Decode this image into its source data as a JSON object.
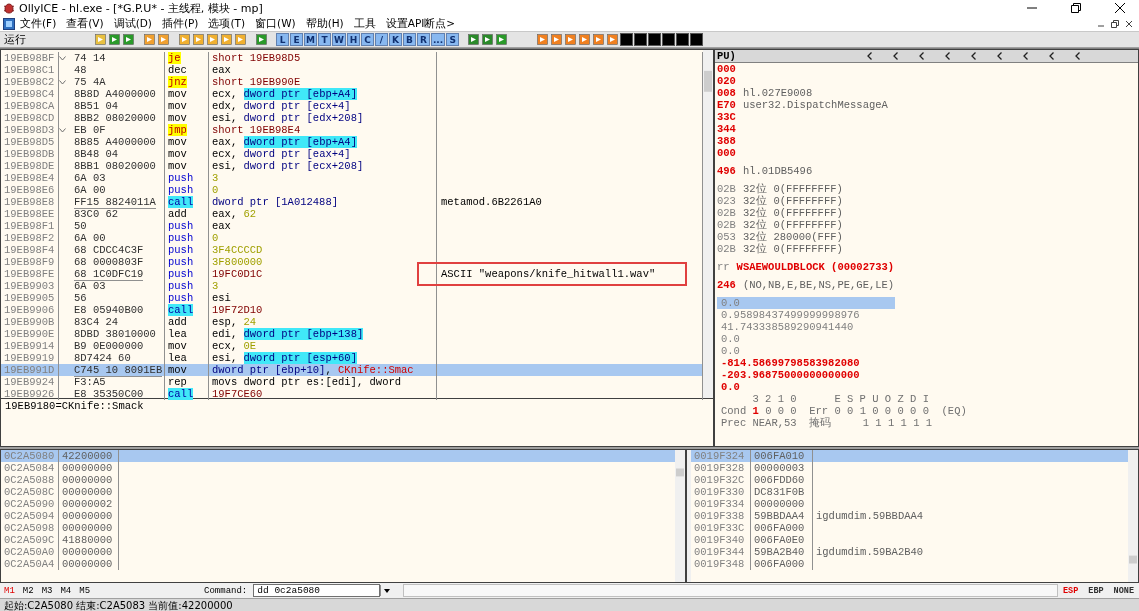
{
  "window": {
    "title": "OllyICE - hl.exe - [*G.P.U* - 主线程, 模块 - mp]"
  },
  "menu": [
    "文件(F)",
    "查看(V)",
    "调试(D)",
    "插件(P)",
    "选项(T)",
    "窗口(W)",
    "帮助(H)",
    "工具",
    "设置API断点>"
  ],
  "toolbar": {
    "status": "运行",
    "window_buttons": [
      "L",
      "E",
      "M",
      "T",
      "W",
      "H",
      "C",
      "/",
      "K",
      "B",
      "R",
      "...",
      "S"
    ]
  },
  "disassembly": {
    "rows": [
      {
        "address": "19EB98BF",
        "jump_mark": true,
        "hex": "74 14",
        "relocated": false,
        "mnemonic": "je",
        "kind": "jump",
        "operands": [
          {
            "text": "short 19EB98D5",
            "kind": "target"
          }
        ],
        "selected": false
      },
      {
        "address": "19EB98C1",
        "jump_mark": false,
        "hex": "48",
        "relocated": false,
        "mnemonic": "dec",
        "kind": "plain",
        "operands": [
          {
            "text": "eax",
            "kind": "reg"
          }
        ],
        "selected": false
      },
      {
        "address": "19EB98C2",
        "jump_mark": true,
        "hex": "75 4A",
        "relocated": false,
        "mnemonic": "jnz",
        "kind": "jump",
        "operands": [
          {
            "text": "short 19EB990E",
            "kind": "target"
          }
        ],
        "selected": false
      },
      {
        "address": "19EB98C4",
        "jump_mark": false,
        "hex": "8B8D A4000000",
        "relocated": false,
        "mnemonic": "mov",
        "kind": "plain",
        "operands": [
          {
            "text": "ecx, ",
            "kind": "reg"
          },
          {
            "text": "dword ptr [ebp+A4]",
            "kind": "mem_hl"
          }
        ],
        "selected": false
      },
      {
        "address": "19EB98CA",
        "jump_mark": false,
        "hex": "8B51 04",
        "relocated": false,
        "mnemonic": "mov",
        "kind": "plain",
        "operands": [
          {
            "text": "edx, ",
            "kind": "reg"
          },
          {
            "text": "dword ptr [ecx+4]",
            "kind": "mem"
          }
        ],
        "selected": false
      },
      {
        "address": "19EB98CD",
        "jump_mark": false,
        "hex": "8BB2 08020000",
        "relocated": false,
        "mnemonic": "mov",
        "kind": "plain",
        "operands": [
          {
            "text": "esi, ",
            "kind": "reg"
          },
          {
            "text": "dword ptr [edx+208]",
            "kind": "mem"
          }
        ],
        "selected": false
      },
      {
        "address": "19EB98D3",
        "jump_mark": true,
        "hex": "EB 0F",
        "relocated": false,
        "mnemonic": "jmp",
        "kind": "jump",
        "operands": [
          {
            "text": "short 19EB98E4",
            "kind": "target"
          }
        ],
        "selected": false
      },
      {
        "address": "19EB98D5",
        "jump_mark": false,
        "hex": "8B85 A4000000",
        "relocated": false,
        "mnemonic": "mov",
        "kind": "plain",
        "operands": [
          {
            "text": "eax, ",
            "kind": "reg"
          },
          {
            "text": "dword ptr [ebp+A4]",
            "kind": "mem_hl"
          }
        ],
        "selected": false
      },
      {
        "address": "19EB98DB",
        "jump_mark": false,
        "hex": "8B48 04",
        "relocated": false,
        "mnemonic": "mov",
        "kind": "plain",
        "operands": [
          {
            "text": "ecx, ",
            "kind": "reg"
          },
          {
            "text": "dword ptr [eax+4]",
            "kind": "mem"
          }
        ],
        "selected": false
      },
      {
        "address": "19EB98DE",
        "jump_mark": false,
        "hex": "8BB1 08020000",
        "relocated": false,
        "mnemonic": "mov",
        "kind": "plain",
        "operands": [
          {
            "text": "esi, ",
            "kind": "reg"
          },
          {
            "text": "dword ptr [ecx+208]",
            "kind": "mem"
          }
        ],
        "selected": false
      },
      {
        "address": "19EB98E4",
        "jump_mark": false,
        "hex": "6A 03",
        "relocated": false,
        "mnemonic": "push",
        "kind": "push",
        "operands": [
          {
            "text": "3",
            "kind": "imm"
          }
        ],
        "selected": false
      },
      {
        "address": "19EB98E6",
        "jump_mark": false,
        "hex": "6A 00",
        "relocated": false,
        "mnemonic": "push",
        "kind": "push",
        "operands": [
          {
            "text": "0",
            "kind": "imm"
          }
        ],
        "selected": false
      },
      {
        "address": "19EB98E8",
        "jump_mark": false,
        "hex": "FF15 8824011A",
        "relocated": true,
        "mnemonic": "call",
        "kind": "call",
        "operands": [
          {
            "text": "dword ptr [1A012488]",
            "kind": "mem"
          }
        ],
        "comment": {
          "text": "metamod.6B2261A0",
          "boxed": false
        },
        "selected": false
      },
      {
        "address": "19EB98EE",
        "jump_mark": false,
        "hex": "83C0 62",
        "relocated": false,
        "mnemonic": "add",
        "kind": "plain",
        "operands": [
          {
            "text": "eax, ",
            "kind": "reg"
          },
          {
            "text": "62",
            "kind": "imm"
          }
        ],
        "selected": false
      },
      {
        "address": "19EB98F1",
        "jump_mark": false,
        "hex": "50",
        "relocated": false,
        "mnemonic": "push",
        "kind": "push",
        "operands": [
          {
            "text": "eax",
            "kind": "reg"
          }
        ],
        "selected": false
      },
      {
        "address": "19EB98F2",
        "jump_mark": false,
        "hex": "6A 00",
        "relocated": false,
        "mnemonic": "push",
        "kind": "push",
        "operands": [
          {
            "text": "0",
            "kind": "imm"
          }
        ],
        "selected": false
      },
      {
        "address": "19EB98F4",
        "jump_mark": false,
        "hex": "68 CDCC4C3F",
        "relocated": false,
        "mnemonic": "push",
        "kind": "push",
        "operands": [
          {
            "text": "3F4CCCCD",
            "kind": "imm"
          }
        ],
        "selected": false
      },
      {
        "address": "19EB98F9",
        "jump_mark": false,
        "hex": "68 0000803F",
        "relocated": false,
        "mnemonic": "push",
        "kind": "push",
        "operands": [
          {
            "text": "3F800000",
            "kind": "imm"
          }
        ],
        "selected": false
      },
      {
        "address": "19EB98FE",
        "jump_mark": false,
        "hex": "68 1C0DFC19",
        "relocated": true,
        "mnemonic": "push",
        "kind": "push",
        "operands": [
          {
            "text": "19FC0D1C",
            "kind": "target"
          }
        ],
        "comment": {
          "text": "ASCII \"weapons/knife_hitwall1.wav\"",
          "boxed": true
        },
        "selected": false
      },
      {
        "address": "19EB9903",
        "jump_mark": false,
        "hex": "6A 03",
        "relocated": false,
        "mnemonic": "push",
        "kind": "push",
        "operands": [
          {
            "text": "3",
            "kind": "imm"
          }
        ],
        "selected": false
      },
      {
        "address": "19EB9905",
        "jump_mark": false,
        "hex": "56",
        "relocated": false,
        "mnemonic": "push",
        "kind": "push",
        "operands": [
          {
            "text": "esi",
            "kind": "reg"
          }
        ],
        "selected": false
      },
      {
        "address": "19EB9906",
        "jump_mark": false,
        "hex": "E8 05940B00",
        "relocated": false,
        "mnemonic": "call",
        "kind": "call",
        "operands": [
          {
            "text": "19F72D10",
            "kind": "target"
          }
        ],
        "selected": false
      },
      {
        "address": "19EB990B",
        "jump_mark": false,
        "hex": "83C4 24",
        "relocated": false,
        "mnemonic": "add",
        "kind": "plain",
        "operands": [
          {
            "text": "esp, ",
            "kind": "reg"
          },
          {
            "text": "24",
            "kind": "imm"
          }
        ],
        "selected": false
      },
      {
        "address": "19EB990E",
        "jump_mark": false,
        "hex": "8DBD 38010000",
        "relocated": false,
        "mnemonic": "lea",
        "kind": "plain",
        "operands": [
          {
            "text": "edi, ",
            "kind": "reg"
          },
          {
            "text": "dword ptr [ebp+138]",
            "kind": "mem_hl"
          }
        ],
        "selected": false
      },
      {
        "address": "19EB9914",
        "jump_mark": false,
        "hex": "B9 0E000000",
        "relocated": false,
        "mnemonic": "mov",
        "kind": "plain",
        "operands": [
          {
            "text": "ecx, ",
            "kind": "reg"
          },
          {
            "text": "0E",
            "kind": "imm"
          }
        ],
        "selected": false
      },
      {
        "address": "19EB9919",
        "jump_mark": false,
        "hex": "8D7424 60",
        "relocated": false,
        "mnemonic": "lea",
        "kind": "plain",
        "operands": [
          {
            "text": "esi, ",
            "kind": "reg"
          },
          {
            "text": "dword ptr [esp+60]",
            "kind": "mem_hl"
          }
        ],
        "selected": false
      },
      {
        "address": "19EB991D",
        "jump_mark": false,
        "hex": "C745 10 8091EB",
        "relocated": true,
        "mnemonic": "mov",
        "kind": "plain",
        "operands": [
          {
            "text": "dword ptr [ebp+10]",
            "kind": "mem"
          },
          {
            "text": ", ",
            "kind": "reg"
          },
          {
            "text": "CKnife::Smac",
            "kind": "label"
          }
        ],
        "selected": true
      },
      {
        "address": "19EB9924",
        "jump_mark": false,
        "hex": "F3:A5",
        "relocated": false,
        "mnemonic": "rep",
        "kind": "plain",
        "operands": [
          {
            "text": "movs dword ptr es:[edi], dword",
            "kind": "reg"
          }
        ],
        "selected": false
      },
      {
        "address": "19EB9926",
        "jump_mark": false,
        "hex": "E8 35350C00",
        "relocated": false,
        "mnemonic": "call",
        "kind": "call",
        "operands": [
          {
            "text": "19F7CE60",
            "kind": "target"
          }
        ],
        "selected": false
      }
    ],
    "info": "19EB9180=CKnife::Smack"
  },
  "registers": {
    "header": "PU)",
    "rows": [
      {
        "kind": "reg",
        "value": "000",
        "changed": true
      },
      {
        "kind": "reg",
        "value": "020",
        "changed": true
      },
      {
        "kind": "reg",
        "value": "008",
        "changed": true,
        "comment": "hl.027E9008"
      },
      {
        "kind": "reg",
        "value": "E70",
        "changed": true,
        "comment": "user32.DispatchMessageA"
      },
      {
        "kind": "reg",
        "value": "33C",
        "changed": true
      },
      {
        "kind": "reg",
        "value": "344",
        "changed": true
      },
      {
        "kind": "reg",
        "value": "388",
        "changed": true
      },
      {
        "kind": "reg",
        "value": "000",
        "changed": true
      },
      {
        "kind": "gap"
      },
      {
        "kind": "reg",
        "value": "496",
        "changed": true,
        "comment": "hl.01DB5496"
      },
      {
        "kind": "gap"
      },
      {
        "kind": "seg",
        "value": "02B",
        "bits": "32位",
        "limit": "0(FFFFFFFF)"
      },
      {
        "kind": "seg",
        "value": "023",
        "bits": "32位",
        "limit": "0(FFFFFFFF)"
      },
      {
        "kind": "seg",
        "value": "02B",
        "bits": "32位",
        "limit": "0(FFFFFFFF)"
      },
      {
        "kind": "seg",
        "value": "02B",
        "bits": "32位",
        "limit": "0(FFFFFFFF)"
      },
      {
        "kind": "seg",
        "value": "053",
        "bits": "32位",
        "limit": "280000(FFF)"
      },
      {
        "kind": "seg",
        "value": "02B",
        "bits": "32位",
        "limit": "0(FFFFFFFF)"
      },
      {
        "kind": "gap"
      },
      {
        "kind": "err",
        "label": "rr",
        "message": "WSAEWOULDBLOCK (00002733)"
      },
      {
        "kind": "gap"
      },
      {
        "kind": "reg",
        "value": "246",
        "changed": true,
        "comment": "(NO,NB,E,BE,NS,PE,GE,LE)"
      },
      {
        "kind": "gap"
      },
      {
        "kind": "fpu",
        "value": "0.0",
        "changed": false,
        "selected": true
      },
      {
        "kind": "fpu",
        "value": "0.95898437499999998976",
        "changed": false,
        "selected": false
      },
      {
        "kind": "fpu",
        "value": "41.743338589290941440",
        "changed": false,
        "selected": false
      },
      {
        "kind": "fpu",
        "value": "0.0",
        "changed": false,
        "selected": false
      },
      {
        "kind": "fpu",
        "value": "0.0",
        "changed": false,
        "selected": false
      },
      {
        "kind": "fpu",
        "value": "-814.58699798583982080",
        "changed": true,
        "selected": false
      },
      {
        "kind": "fpu",
        "value": "-203.96875000000000000",
        "changed": true,
        "selected": false
      },
      {
        "kind": "fpu",
        "value": "0.0",
        "changed": true,
        "selected": false
      },
      {
        "kind": "text",
        "parts": [
          {
            "text": "     3 2 1 0      E S P U O Z D I",
            "changed": false
          }
        ]
      },
      {
        "kind": "text",
        "parts": [
          {
            "text": "Cond ",
            "changed": false
          },
          {
            "text": "1",
            "changed": true
          },
          {
            "text": " 0 0 0  Err 0 0 1 0 0 0 0 0  (EQ)",
            "changed": false
          }
        ]
      },
      {
        "kind": "text",
        "parts": [
          {
            "text": "Prec NEAR,53  掩码     1 1 1 1 1 1",
            "changed": false
          }
        ]
      }
    ]
  },
  "dump": {
    "rows": [
      {
        "address": "0C2A5080",
        "value": "42200000",
        "selected": true
      },
      {
        "address": "0C2A5084",
        "value": "00000000",
        "selected": false
      },
      {
        "address": "0C2A5088",
        "value": "00000000",
        "selected": false
      },
      {
        "address": "0C2A508C",
        "value": "00000000",
        "selected": false
      },
      {
        "address": "0C2A5090",
        "value": "00000002",
        "selected": false
      },
      {
        "address": "0C2A5094",
        "value": "00000000",
        "selected": false
      },
      {
        "address": "0C2A5098",
        "value": "00000000",
        "selected": false
      },
      {
        "address": "0C2A509C",
        "value": "41880000",
        "selected": false
      },
      {
        "address": "0C2A50A0",
        "value": "00000000",
        "selected": false
      },
      {
        "address": "0C2A50A4",
        "value": "00000000",
        "selected": false
      }
    ]
  },
  "stack": {
    "rows": [
      {
        "address": "0019F324",
        "value": "006FA010",
        "selected": true
      },
      {
        "address": "0019F328",
        "value": "00000003",
        "selected": false
      },
      {
        "address": "0019F32C",
        "value": "006FDD60",
        "selected": false
      },
      {
        "address": "0019F330",
        "value": "DC831F0B",
        "selected": false
      },
      {
        "address": "0019F334",
        "value": "00000000",
        "selected": false
      },
      {
        "address": "0019F338",
        "value": "59BBDAA4",
        "comment": "igdumdim.59BBDAA4",
        "selected": false
      },
      {
        "address": "0019F33C",
        "value": "006FA000",
        "selected": false
      },
      {
        "address": "0019F340",
        "value": "006FA0E0",
        "selected": false
      },
      {
        "address": "0019F344",
        "value": "59BA2B40",
        "comment": "igdumdim.59BA2B40",
        "selected": false
      },
      {
        "address": "0019F348",
        "value": "006FA000",
        "selected": false
      }
    ]
  },
  "command_bar": {
    "memory_tabs": [
      {
        "label": "M1",
        "selected": true
      },
      {
        "label": "M2",
        "selected": false
      },
      {
        "label": "M3",
        "selected": false
      },
      {
        "label": "M4",
        "selected": false
      },
      {
        "label": "M5",
        "selected": false
      }
    ],
    "label": "Command:",
    "value": "dd 0c2a5080",
    "stack_modes": [
      {
        "label": "ESP",
        "selected": true
      },
      {
        "label": "EBP",
        "selected": false
      },
      {
        "label": "NONE",
        "selected": false
      }
    ]
  },
  "status_bar": "起始:C2A5080 结束:C2A5083 当前值:42200000"
}
